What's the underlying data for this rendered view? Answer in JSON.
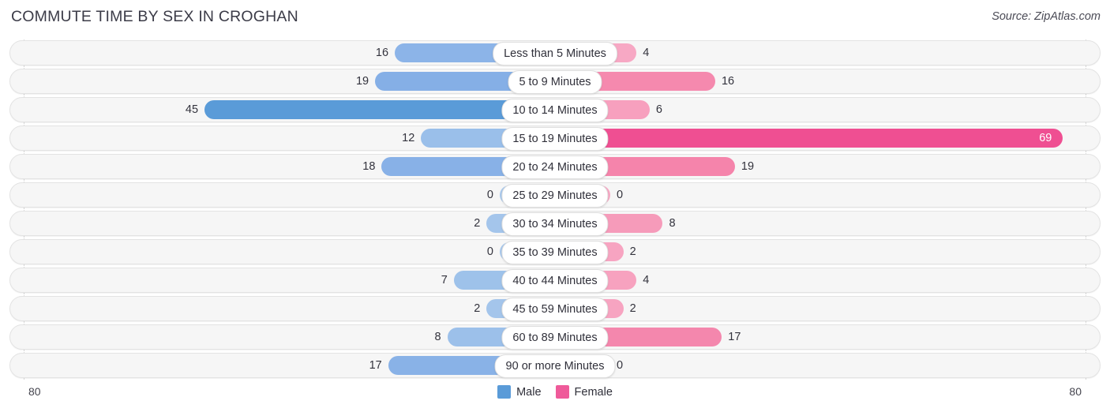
{
  "header": {
    "title": "COMMUTE TIME BY SEX IN CROGHAN",
    "source": "Source: ZipAtlas.com"
  },
  "axis": {
    "left_label": "80",
    "right_label": "80",
    "max": 80
  },
  "legend": {
    "items": [
      {
        "label": "Male",
        "color": "#5a9bd8",
        "name": "legend-male"
      },
      {
        "label": "Female",
        "color": "#ef5a9a",
        "name": "legend-female"
      }
    ]
  },
  "colors": {
    "male_light": "#a8c8ec",
    "male_mid": "#8cb4e8",
    "male_dark": "#5a9bd8",
    "female_light": "#f7a8c4",
    "female_mid": "#f589ae",
    "female_dark": "#ef4f92",
    "track": "#f6f6f6",
    "track_border": "#e3e3e3",
    "gridline": "#d8d8d8"
  },
  "chart_data": {
    "type": "bar",
    "title": "COMMUTE TIME BY SEX IN CROGHAN",
    "subtitle": "Source: ZipAtlas.com",
    "orientation": "horizontal-diverging",
    "xlabel": "",
    "ylabel": "",
    "xlim": [
      80,
      80
    ],
    "grid": true,
    "legend_position": "bottom-center",
    "categories": [
      "Less than 5 Minutes",
      "5 to 9 Minutes",
      "10 to 14 Minutes",
      "15 to 19 Minutes",
      "20 to 24 Minutes",
      "25 to 29 Minutes",
      "30 to 34 Minutes",
      "35 to 39 Minutes",
      "40 to 44 Minutes",
      "45 to 59 Minutes",
      "60 to 89 Minutes",
      "90 or more Minutes"
    ],
    "series": [
      {
        "name": "Male",
        "color": "#5a9bd8",
        "values": [
          16,
          19,
          45,
          12,
          18,
          0,
          2,
          0,
          7,
          2,
          8,
          17
        ]
      },
      {
        "name": "Female",
        "color": "#ef5a9a",
        "values": [
          4,
          16,
          6,
          69,
          19,
          0,
          8,
          2,
          4,
          2,
          17,
          0
        ]
      }
    ],
    "rows": [
      {
        "category": "Less than 5 Minutes",
        "male": 16,
        "female": 4,
        "male_color": "#8cb4e8",
        "female_color": "#f7a8c4",
        "female_inside": false
      },
      {
        "category": "5 to 9 Minutes",
        "male": 19,
        "female": 16,
        "male_color": "#85afe6",
        "female_color": "#f589ae",
        "female_inside": false
      },
      {
        "category": "10 to 14 Minutes",
        "male": 45,
        "female": 6,
        "male_color": "#5a9bd8",
        "female_color": "#f7a0be",
        "female_inside": false
      },
      {
        "category": "15 to 19 Minutes",
        "male": 12,
        "female": 69,
        "male_color": "#9abfea",
        "female_color": "#ef4f92",
        "female_inside": true
      },
      {
        "category": "20 to 24 Minutes",
        "male": 18,
        "female": 19,
        "male_color": "#88b1e7",
        "female_color": "#f584ab",
        "female_inside": false
      },
      {
        "category": "25 to 29 Minutes",
        "male": 0,
        "female": 0,
        "male_color": "#a8c8ec",
        "female_color": "#f7a8c4",
        "female_inside": false
      },
      {
        "category": "30 to 34 Minutes",
        "male": 2,
        "female": 8,
        "male_color": "#a4c5eb",
        "female_color": "#f69bba",
        "female_inside": false
      },
      {
        "category": "35 to 39 Minutes",
        "male": 0,
        "female": 2,
        "male_color": "#a8c8ec",
        "female_color": "#f7a4c1",
        "female_inside": false
      },
      {
        "category": "40 to 44 Minutes",
        "male": 7,
        "female": 4,
        "male_color": "#9ec2ea",
        "female_color": "#f7a2bf",
        "female_inside": false
      },
      {
        "category": "45 to 59 Minutes",
        "male": 2,
        "female": 2,
        "male_color": "#a4c5eb",
        "female_color": "#f7a4c1",
        "female_inside": false
      },
      {
        "category": "60 to 89 Minutes",
        "male": 8,
        "female": 17,
        "male_color": "#9cc0ea",
        "female_color": "#f487ad",
        "female_inside": false
      },
      {
        "category": "90 or more Minutes",
        "male": 17,
        "female": 0,
        "male_color": "#89b2e7",
        "female_color": "#f7a8c4",
        "female_inside": false
      }
    ]
  }
}
